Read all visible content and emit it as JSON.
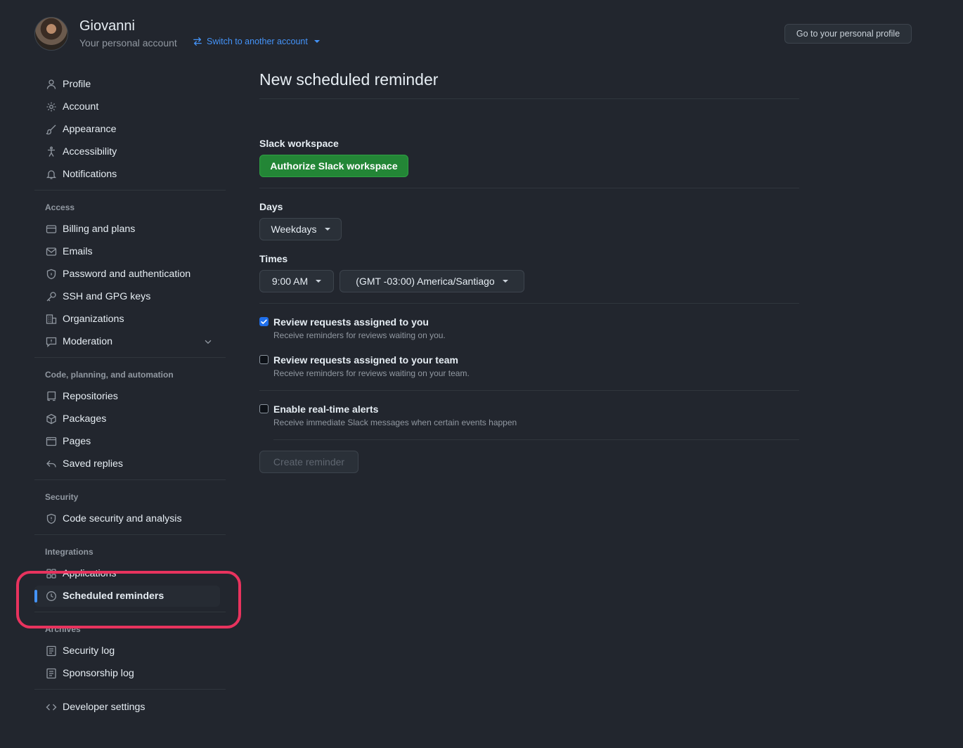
{
  "header": {
    "account_name": "Giovanni",
    "account_sub": "Your personal account",
    "switch_label": "Switch to another account",
    "profile_button": "Go to your personal profile"
  },
  "sidebar": {
    "group_main": [
      {
        "label": "Profile",
        "icon": "person-icon"
      },
      {
        "label": "Account",
        "icon": "gear-icon"
      },
      {
        "label": "Appearance",
        "icon": "paintbrush-icon"
      },
      {
        "label": "Accessibility",
        "icon": "accessibility-icon"
      },
      {
        "label": "Notifications",
        "icon": "bell-icon"
      }
    ],
    "access_title": "Access",
    "group_access": [
      {
        "label": "Billing and plans",
        "icon": "credit-card-icon"
      },
      {
        "label": "Emails",
        "icon": "mail-icon"
      },
      {
        "label": "Password and authentication",
        "icon": "shield-lock-icon"
      },
      {
        "label": "SSH and GPG keys",
        "icon": "key-icon"
      },
      {
        "label": "Organizations",
        "icon": "organization-icon"
      },
      {
        "label": "Moderation",
        "icon": "report-icon"
      }
    ],
    "code_title": "Code, planning, and automation",
    "group_code": [
      {
        "label": "Repositories",
        "icon": "repo-icon"
      },
      {
        "label": "Packages",
        "icon": "package-icon"
      },
      {
        "label": "Pages",
        "icon": "browser-icon"
      },
      {
        "label": "Saved replies",
        "icon": "reply-icon"
      }
    ],
    "security_title": "Security",
    "group_security": [
      {
        "label": "Code security and analysis",
        "icon": "shield-icon"
      }
    ],
    "integrations_title": "Integrations",
    "group_integrations": [
      {
        "label": "Applications",
        "icon": "apps-icon"
      },
      {
        "label": "Scheduled reminders",
        "icon": "clock-icon"
      }
    ],
    "archives_title": "Archives",
    "group_archives": [
      {
        "label": "Security log",
        "icon": "log-icon"
      },
      {
        "label": "Sponsorship log",
        "icon": "log-icon"
      }
    ],
    "group_dev": [
      {
        "label": "Developer settings",
        "icon": "code-icon"
      }
    ]
  },
  "main": {
    "title": "New scheduled reminder",
    "slack_label": "Slack workspace",
    "slack_button": "Authorize Slack workspace",
    "days_label": "Days",
    "days_value": "Weekdays",
    "times_label": "Times",
    "time_value": "9:00 AM",
    "timezone_value": "(GMT -03:00) America/Santiago",
    "options": [
      {
        "label": "Review requests assigned to you",
        "note": "Receive reminders for reviews waiting on you.",
        "checked": true
      },
      {
        "label": "Review requests assigned to your team",
        "note": "Receive reminders for reviews waiting on your team.",
        "checked": false
      },
      {
        "label": "Enable real-time alerts",
        "note": "Receive immediate Slack messages when certain events happen",
        "checked": false
      }
    ],
    "create_button": "Create reminder"
  },
  "colors": {
    "background": "#22262e",
    "accent": "#4493f8",
    "primary_button": "#238636",
    "highlight": "#e8335e"
  }
}
